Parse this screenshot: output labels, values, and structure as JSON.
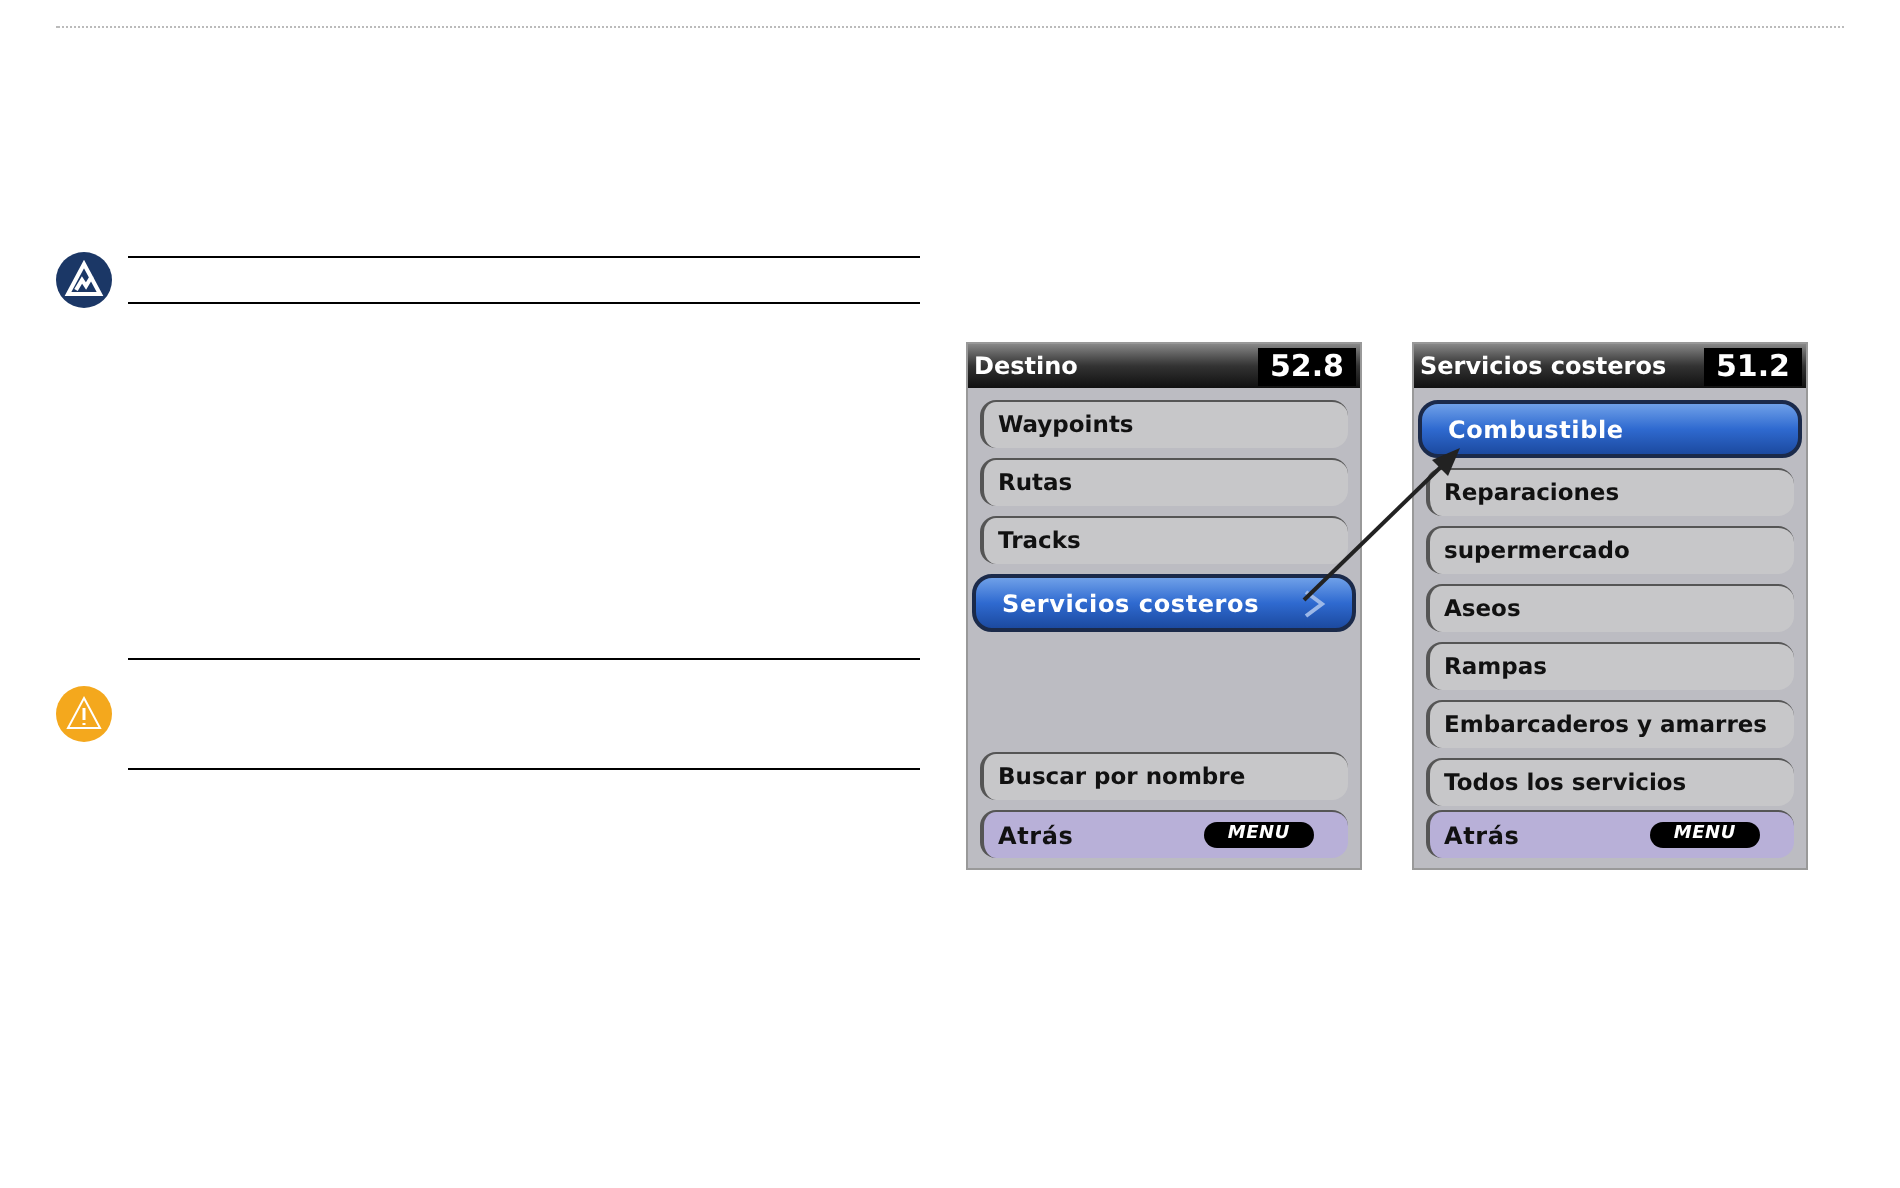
{
  "notices": [
    {
      "kind": "note"
    },
    {
      "kind": "warning"
    }
  ],
  "screens": [
    {
      "title": "Destino",
      "reading": "52.8",
      "items": [
        {
          "label": "Waypoints",
          "selected": false,
          "chevron": false
        },
        {
          "label": "Rutas",
          "selected": false,
          "chevron": false
        },
        {
          "label": "Tracks",
          "selected": false,
          "chevron": false
        },
        {
          "label": "Servicios costeros",
          "selected": true,
          "chevron": true
        }
      ],
      "footer_items": [
        {
          "label": "Buscar por nombre",
          "kind": "item"
        },
        {
          "label": "Atrás",
          "kind": "back",
          "key": "MENU"
        }
      ]
    },
    {
      "title": "Servicios costeros",
      "reading": "51.2",
      "items": [
        {
          "label": "Combustible",
          "selected": true,
          "chevron": false
        },
        {
          "label": "Reparaciones",
          "selected": false,
          "chevron": false
        },
        {
          "label": "supermercado",
          "selected": false,
          "chevron": false
        },
        {
          "label": "Aseos",
          "selected": false,
          "chevron": false
        },
        {
          "label": "Rampas",
          "selected": false,
          "chevron": false
        },
        {
          "label": "Embarcaderos y amarres",
          "selected": false,
          "chevron": false
        },
        {
          "label": "Todos los servicios",
          "selected": false,
          "chevron": false
        }
      ],
      "footer_items": [
        {
          "label": "Atrás",
          "kind": "back",
          "key": "MENU"
        }
      ]
    }
  ]
}
